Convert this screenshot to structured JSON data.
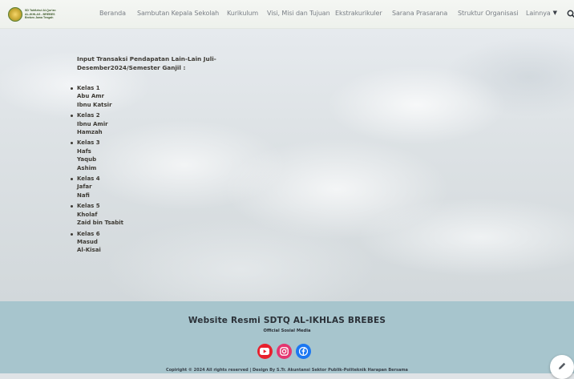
{
  "header": {
    "logo": {
      "line1": "SD Tahfizhul Al-Qur'an",
      "line2": "AL-IKHLAS - BREBES",
      "line3": "Brebes Jawa Tengah"
    },
    "nav": [
      {
        "label": "Beranda"
      },
      {
        "label": "Sambutan Kepala Sekolah"
      },
      {
        "label": "Kurikulum"
      },
      {
        "label": "Visi, Misi dan Tujuan"
      },
      {
        "label": "Ekstrakurikuler"
      },
      {
        "label": "Sarana Prasarana"
      },
      {
        "label": "Struktur Organisasi"
      },
      {
        "label": "Lainnya"
      }
    ],
    "search_icon": "search-icon"
  },
  "main": {
    "title": "Input Transaksi Pendapatan Lain-Lain  Juli-Desember2024/Semester Ganjil :",
    "classes": [
      {
        "label": "Kelas 1",
        "items": [
          "Abu Amr",
          "Ibnu Katsir"
        ]
      },
      {
        "label": "Kelas 2",
        "items": [
          "Ibnu Amir",
          "Hamzah"
        ]
      },
      {
        "label": "Kelas 3",
        "items": [
          "Hafs",
          "Yaqub",
          "Ashim"
        ]
      },
      {
        "label": "Kelas 4",
        "items": [
          "Jafar",
          "Nafi"
        ]
      },
      {
        "label": "Kelas 5",
        "items": [
          "Kholaf",
          "Zaid bin Tsabit"
        ]
      },
      {
        "label": "Kelas 6",
        "items": [
          "Masud",
          "Al-Kisai"
        ]
      }
    ]
  },
  "footer": {
    "title": "Website Resmi SDTQ AL-IKHLAS BREBES",
    "subtitle": "Official Sosial Media",
    "social": [
      "youtube-icon",
      "instagram-icon",
      "facebook-icon"
    ],
    "copyright": "Copiright © 2024  All rights reserved | Design By S.Tr. Akuntansi Sektor Publik-Politeknik Harapan Bersama"
  },
  "colors": {
    "footer_bg": "#a7c5cd",
    "youtube": "#e8202d",
    "instagram": "#e4356f",
    "facebook": "#1b77f2"
  }
}
